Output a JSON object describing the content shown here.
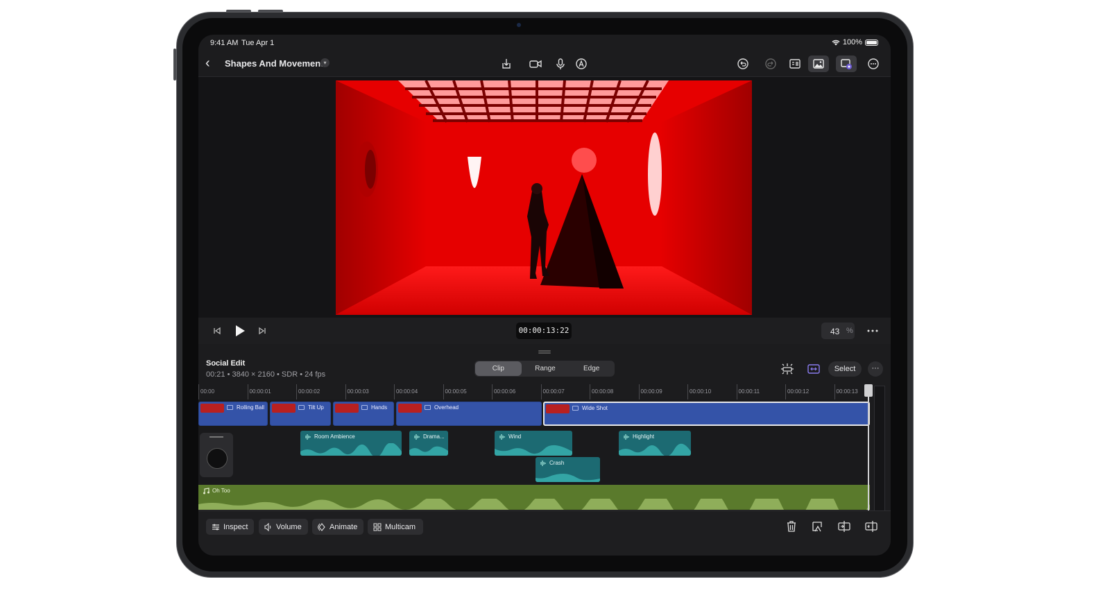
{
  "status": {
    "time": "9:41 AM",
    "date": "Tue Apr 1",
    "battery": "100%"
  },
  "toolbar": {
    "title": "Shapes And Movement"
  },
  "transport": {
    "timecode": "00:00:13:22",
    "zoom_value": "43",
    "zoom_unit": "%"
  },
  "project": {
    "name": "Social Edit",
    "meta": "00:21 • 3840 × 2160 • SDR • 24 fps"
  },
  "edit_modes": [
    "Clip",
    "Range",
    "Edge"
  ],
  "select_label": "Select",
  "ruler": [
    "00:00",
    "00:00:01",
    "00:00:02",
    "00:00:03",
    "00:00:04",
    "00:00:05",
    "00:00:06",
    "00:00:07",
    "00:00:08",
    "00:00:09",
    "00:00:10",
    "00:00:11",
    "00:00:12",
    "00:00:13"
  ],
  "video_clips": [
    "Rolling Ball",
    "Tilt Up",
    "Hands",
    "Overhead",
    "Wide Shot"
  ],
  "audio_clips": [
    "Room Ambience",
    "Drama...",
    "Wind",
    "Highlight",
    "Crash"
  ],
  "music_clip": "Oh Too",
  "bottom": {
    "inspect": "Inspect",
    "volume": "Volume",
    "animate": "Animate",
    "multicam": "Multicam"
  },
  "colors": {
    "video_clip": "#3453a8",
    "audio_clip": "#1c6a72",
    "music_clip": "#5a7a2c",
    "scene_red": "#e00000"
  }
}
